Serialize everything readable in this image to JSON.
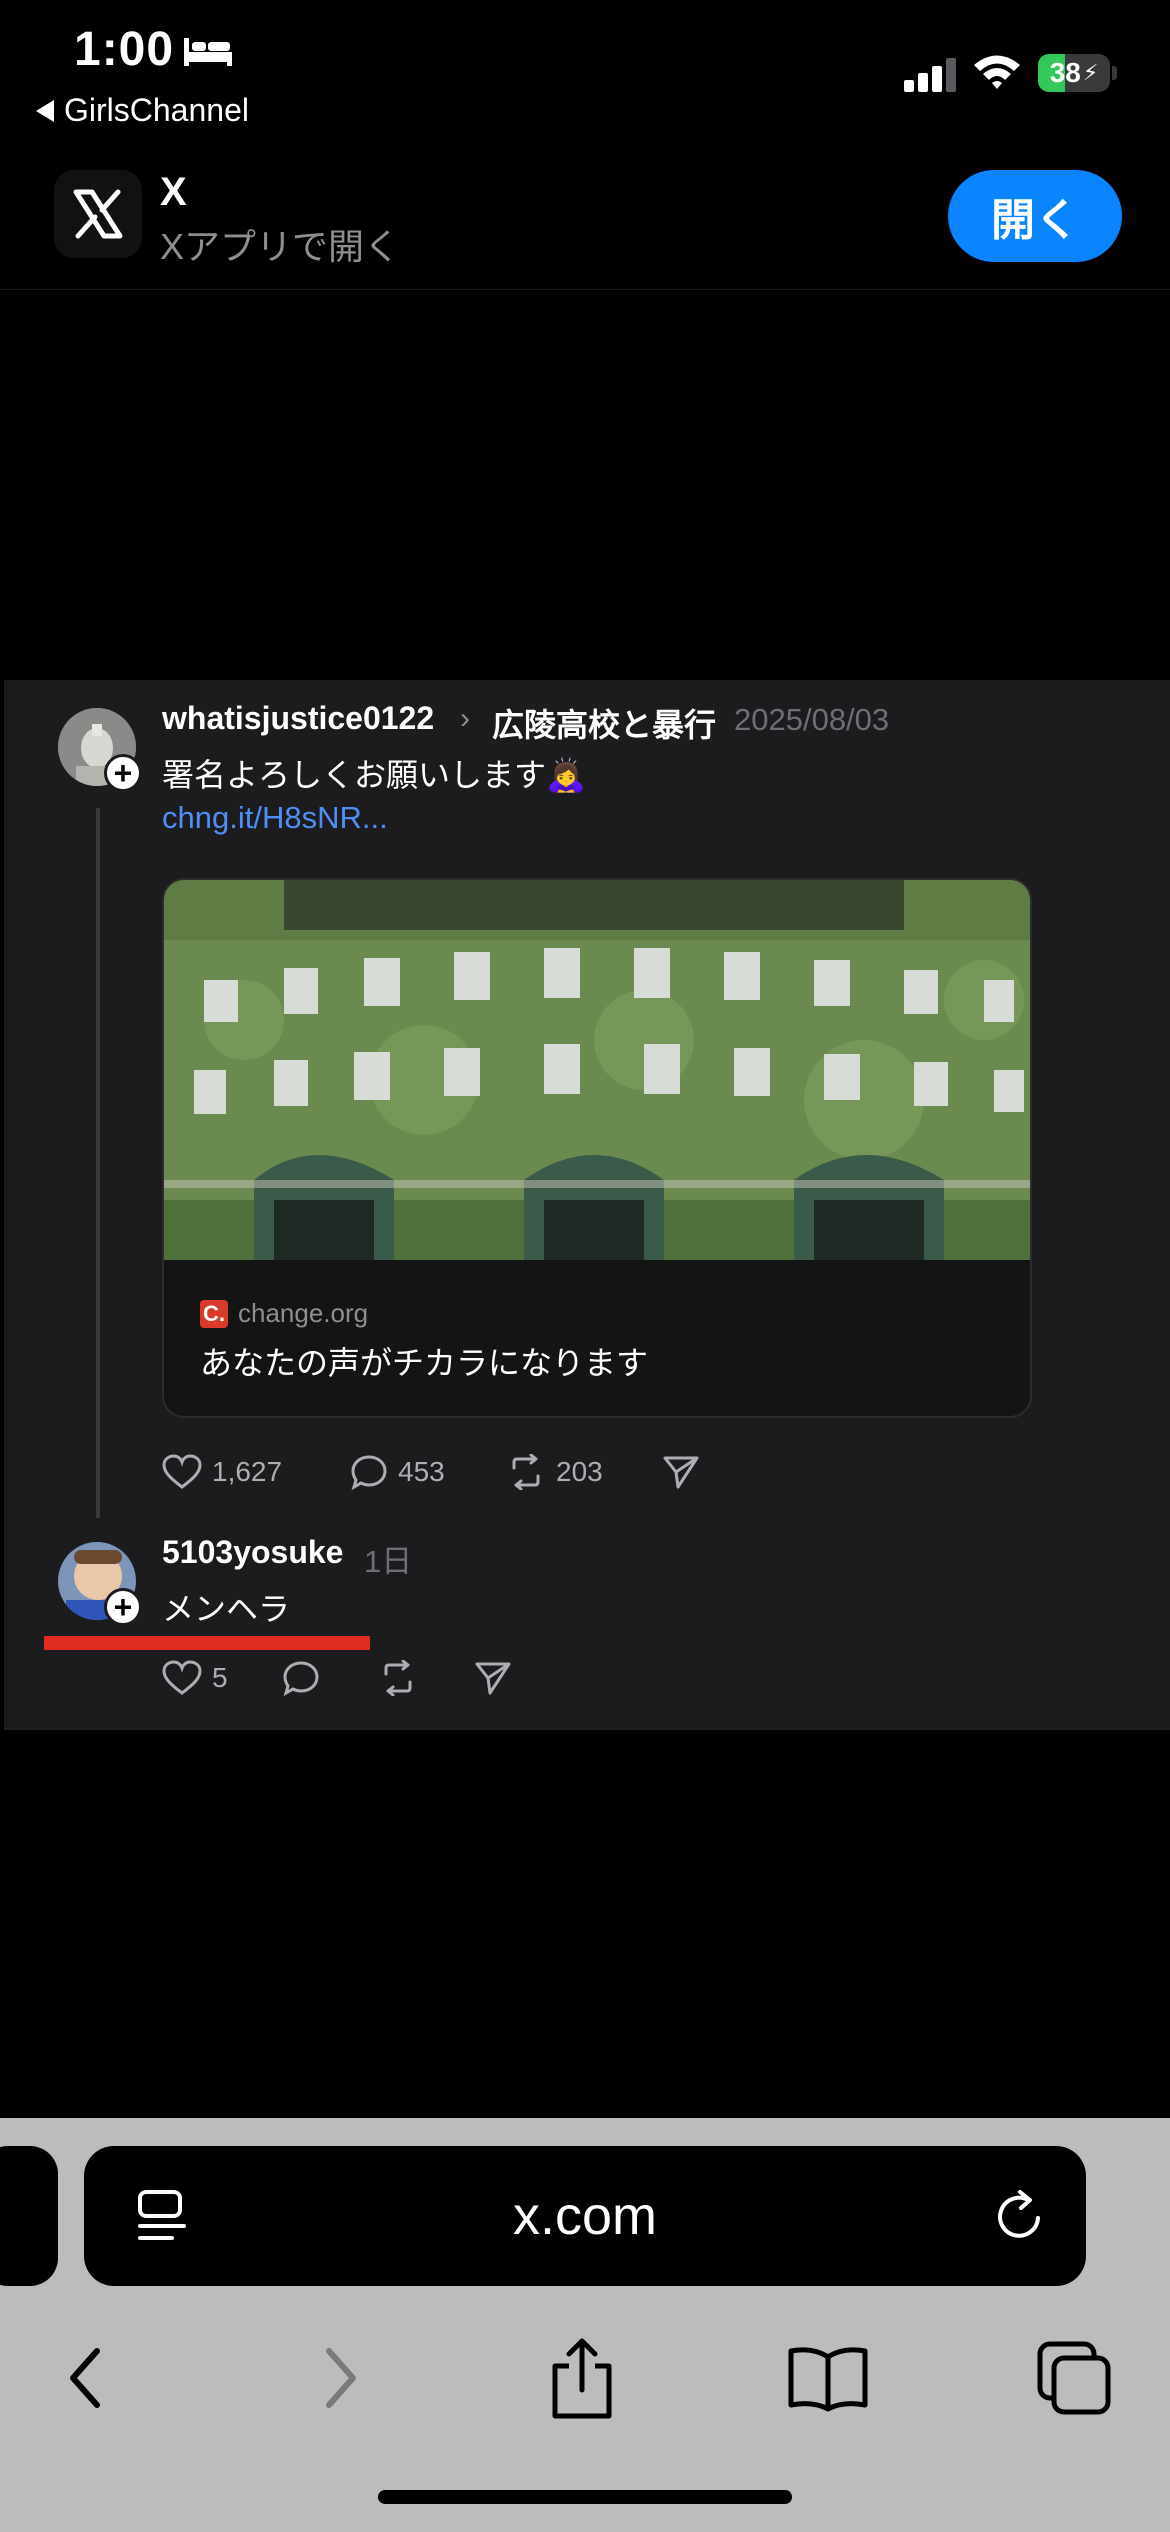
{
  "status_bar": {
    "time": "1:00",
    "back_app": "GirlsChannel",
    "battery": "38",
    "battery_level": 0.38
  },
  "banner": {
    "app_name": "X",
    "subtitle": "Xアプリで開く",
    "open_label": "開く"
  },
  "embed": {
    "posts": [
      {
        "username": "whatisjustice0122",
        "topic": "広陵高校と暴行",
        "date": "2025/08/03",
        "text": "署名よろしくお願いします🙇‍♀️",
        "link": "chng.it/H8sNR...",
        "card": {
          "source": "change.org",
          "favicon": "C.",
          "title": "あなたの声がチカラになります"
        },
        "likes": "1,627",
        "replies": "453",
        "reposts": "203"
      },
      {
        "username": "5103yosuke",
        "date": "1日",
        "text": "メンヘラ",
        "likes": "5",
        "replies": "",
        "reposts": ""
      }
    ]
  },
  "safari": {
    "url": "x.com"
  },
  "icons": {
    "bed": "bed-icon",
    "signal": "cellular-signal-icon",
    "wifi": "wifi-icon",
    "like": "heart-icon",
    "reply": "comment-icon",
    "repost": "repost-icon",
    "share": "send-icon",
    "reader": "reader-mode-icon",
    "reload": "reload-icon",
    "back": "chevron-left-icon",
    "forward": "chevron-right-icon",
    "share_sheet": "share-icon",
    "bookmarks": "book-icon",
    "tabs": "tabs-icon"
  },
  "colors": {
    "accent": "#0a84ff",
    "link": "#4f8ef7",
    "battery": "#34c759",
    "highlight": "#e02c20"
  }
}
